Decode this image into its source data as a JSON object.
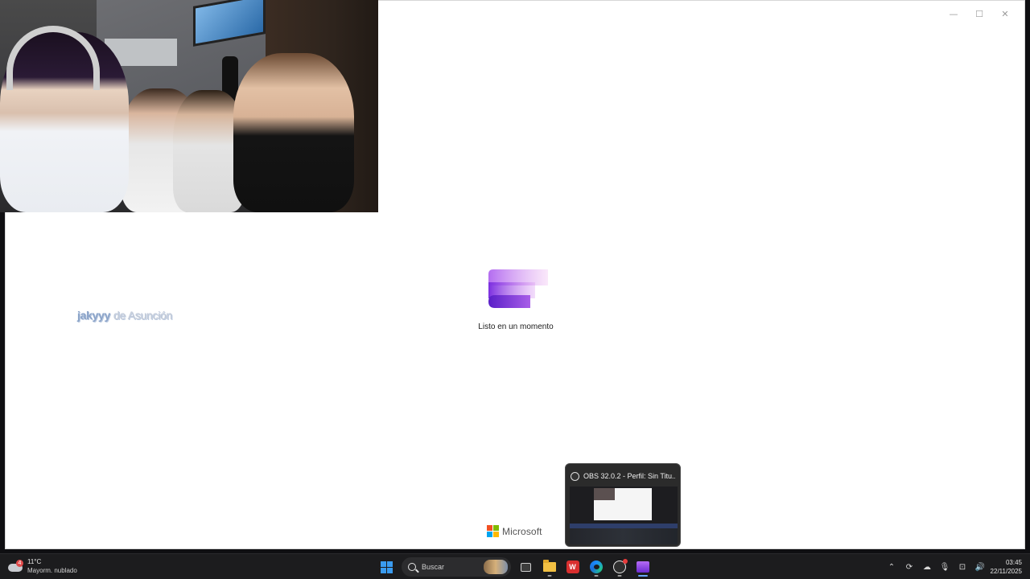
{
  "window": {
    "controls": {
      "minimize": "—",
      "maximize": "☐",
      "close": "✕"
    },
    "splash": {
      "loading_text": "Listo en un momento"
    },
    "footer_brand": "Microsoft"
  },
  "stream_overlay": {
    "name": "jakyyy",
    "suffix": "de Asunción"
  },
  "obs_preview": {
    "title": "OBS 32.0.2 - Perfil: Sin Titu..."
  },
  "taskbar": {
    "weather": {
      "badge": "4",
      "temperature": "11°C",
      "description": "Mayorm. nublado"
    },
    "search": {
      "label": "Buscar"
    },
    "apps": [
      "start-menu",
      "task-view",
      "file-explorer",
      "wps-office",
      "edge",
      "obs-studio",
      "clipchamp"
    ],
    "wps_letter": "W",
    "tray": {
      "chevron": "⌃",
      "sync": "⟳",
      "cloud": "☁",
      "mic": "🎙",
      "network": "⊡",
      "volume": "🔊"
    },
    "clock": {
      "time": "03:45",
      "date": "22/11/2025"
    }
  },
  "colors": {
    "accent": "#3a9bf0",
    "splash_purple": "#8a3ee6",
    "taskbar_bg": "#1c1c1e"
  }
}
